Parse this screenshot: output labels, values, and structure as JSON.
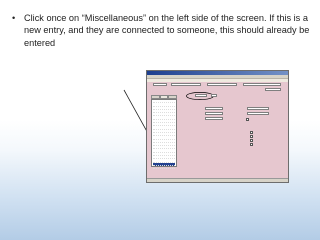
{
  "instruction": {
    "bullet": "•",
    "text": "Click once on “Miscellaneous” on the left side of the screen. If this is a new entry, and they are connected to someone, this should already be entered"
  },
  "colors": {
    "app_background": "#e6c7cf",
    "title_bar": "#1d3f8f",
    "selected_item": "#22418f",
    "pointer_line": "#222222",
    "highlight_oval": "#000000"
  }
}
